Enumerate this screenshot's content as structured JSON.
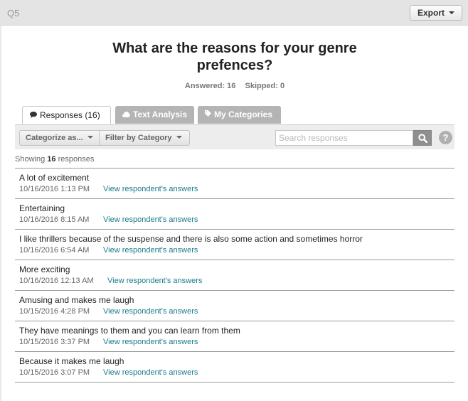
{
  "header": {
    "question_number": "Q5",
    "export_label": "Export"
  },
  "question": {
    "title": "What are the reasons for your genre prefences?",
    "answered": "Answered: 16",
    "skipped": "Skipped: 0"
  },
  "tabs": [
    {
      "label": "Responses",
      "count": "(16)",
      "icon": "speech-bubble-icon"
    },
    {
      "label": "Text Analysis",
      "icon": "cloud-icon"
    },
    {
      "label": "My Categories",
      "icon": "tag-icon"
    }
  ],
  "toolbar": {
    "categorize_label": "Categorize as...",
    "filter_label": "Filter by Category",
    "search_placeholder": "Search responses",
    "help_label": "?"
  },
  "summary": {
    "prefix": "Showing",
    "count": "16",
    "suffix": "responses"
  },
  "responses": [
    {
      "text": "A lot of excitement",
      "date": "10/16/2016 1:13 PM",
      "link": "View respondent's answers"
    },
    {
      "text": "Entertaining",
      "date": "10/16/2016 8:15 AM",
      "link": "View respondent's answers"
    },
    {
      "text": "I like thrillers because of the suspense and there is also some action and sometimes horror",
      "date": "10/16/2016 6:54 AM",
      "link": "View respondent's answers"
    },
    {
      "text": "More exciting",
      "date": "10/16/2016 12:13 AM",
      "link": "View respondent's answers"
    },
    {
      "text": "Amusing and makes me laugh",
      "date": "10/15/2016 4:28 PM",
      "link": "View respondent's answers"
    },
    {
      "text": "They have meanings to them and you can learn from them",
      "date": "10/15/2016 3:37 PM",
      "link": "View respondent's answers"
    },
    {
      "text": "Because it makes me laugh",
      "date": "10/15/2016 3:07 PM",
      "link": "View respondent's answers"
    }
  ],
  "colors": {
    "link": "#1b7a8c",
    "tab_inactive": "#b4b4b4",
    "topbar": "#e4e4e4"
  }
}
